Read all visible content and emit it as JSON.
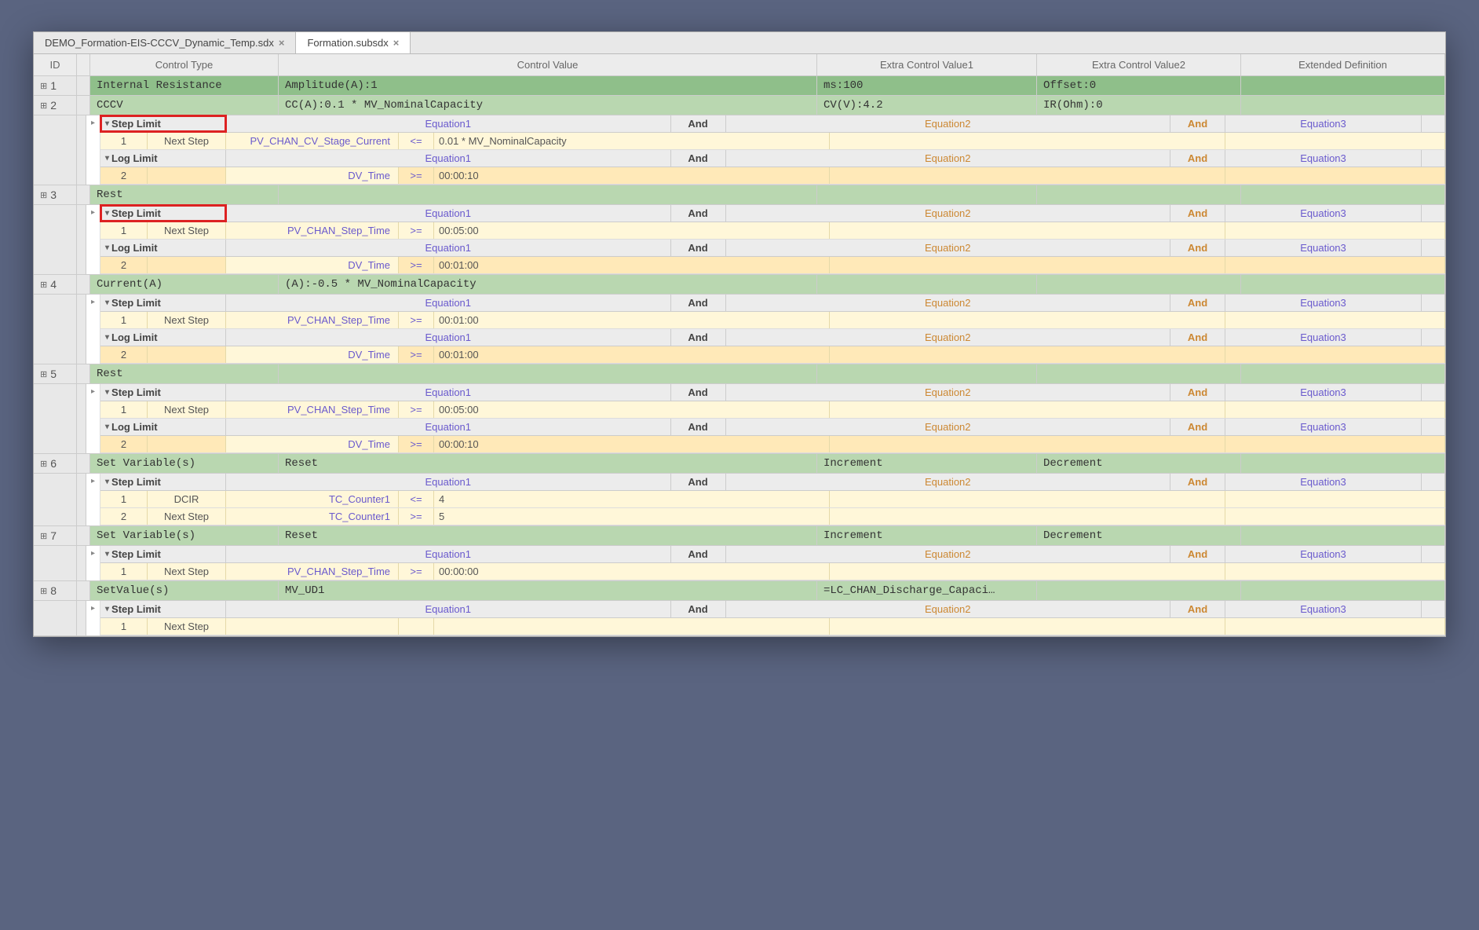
{
  "tabs": [
    {
      "label": "DEMO_Formation-EIS-CCCV_Dynamic_Temp.sdx",
      "active": false
    },
    {
      "label": "Formation.subsdx",
      "active": true
    }
  ],
  "headers": {
    "id": "ID",
    "type": "Control Type",
    "value": "Control Value",
    "extra1": "Extra Control Value1",
    "extra2": "Extra Control Value2",
    "ext": "Extended Definition"
  },
  "limit_labels": {
    "step": "Step Limit",
    "log": "Log Limit",
    "eq1": "Equation1",
    "eq2": "Equation2",
    "eq3": "Equation3",
    "and": "And"
  },
  "steps": [
    {
      "id": "1",
      "rowClass": "darkgreen",
      "type": "Internal Resistance",
      "value": "Amplitude(A):1",
      "extra1": "ms:100",
      "extra2": "Offset:0",
      "limits": []
    },
    {
      "id": "2",
      "rowClass": "green",
      "type": "CCCV",
      "value": "CC(A):0.1 * MV_NominalCapacity",
      "extra1": "CV(V):4.2",
      "extra2": "IR(Ohm):0",
      "limits": [
        {
          "kind": "step",
          "redbox": true,
          "rows": [
            {
              "num": "1",
              "act": "Next Step",
              "var": "PV_CHAN_CV_Stage_Current",
              "op": "<=",
              "val": "0.01 * MV_NominalCapacity"
            }
          ]
        },
        {
          "kind": "log",
          "rows": [
            {
              "num": "2",
              "act": "",
              "var": "DV_Time",
              "op": ">=",
              "val": "00:00:10",
              "orange": true
            }
          ]
        }
      ]
    },
    {
      "id": "3",
      "rowClass": "green",
      "type": "Rest",
      "value": "",
      "extra1": "",
      "extra2": "",
      "limits": [
        {
          "kind": "step",
          "redbox": true,
          "rows": [
            {
              "num": "1",
              "act": "Next Step",
              "var": "PV_CHAN_Step_Time",
              "op": ">=",
              "val": "00:05:00"
            }
          ]
        },
        {
          "kind": "log",
          "rows": [
            {
              "num": "2",
              "act": "",
              "var": "DV_Time",
              "op": ">=",
              "val": "00:01:00",
              "orange": true
            }
          ]
        }
      ]
    },
    {
      "id": "4",
      "rowClass": "green",
      "type": "Current(A)",
      "value": "(A):-0.5 * MV_NominalCapacity",
      "extra1": "",
      "extra2": "",
      "limits": [
        {
          "kind": "step",
          "rows": [
            {
              "num": "1",
              "act": "Next Step",
              "var": "PV_CHAN_Step_Time",
              "op": ">=",
              "val": "00:01:00"
            }
          ]
        },
        {
          "kind": "log",
          "rows": [
            {
              "num": "2",
              "act": "",
              "var": "DV_Time",
              "op": ">=",
              "val": "00:01:00",
              "orange": true
            }
          ]
        }
      ]
    },
    {
      "id": "5",
      "rowClass": "green",
      "type": "Rest",
      "value": "",
      "extra1": "",
      "extra2": "",
      "limits": [
        {
          "kind": "step",
          "rows": [
            {
              "num": "1",
              "act": "Next Step",
              "var": "PV_CHAN_Step_Time",
              "op": ">=",
              "val": "00:05:00"
            }
          ]
        },
        {
          "kind": "log",
          "rows": [
            {
              "num": "2",
              "act": "",
              "var": "DV_Time",
              "op": ">=",
              "val": "00:00:10",
              "orange": true
            }
          ]
        }
      ]
    },
    {
      "id": "6",
      "rowClass": "green",
      "type": "Set Variable(s)",
      "value": "Reset",
      "extra1": "Increment",
      "extra2": "Decrement",
      "limits": [
        {
          "kind": "step",
          "rows": [
            {
              "num": "1",
              "act": "DCIR",
              "var": "TC_Counter1",
              "op": "<=",
              "val": "4"
            },
            {
              "num": "2",
              "act": "Next Step",
              "var": "TC_Counter1",
              "op": ">=",
              "val": "5"
            }
          ]
        }
      ]
    },
    {
      "id": "7",
      "rowClass": "green",
      "type": "Set Variable(s)",
      "value": "Reset",
      "extra1": "Increment",
      "extra2": "Decrement",
      "limits": [
        {
          "kind": "step",
          "rows": [
            {
              "num": "1",
              "act": "Next Step",
              "var": "PV_CHAN_Step_Time",
              "op": ">=",
              "val": "00:00:00"
            }
          ]
        }
      ]
    },
    {
      "id": "8",
      "rowClass": "green",
      "type": "SetValue(s)",
      "value": "MV_UD1",
      "extra1": "=LC_CHAN_Discharge_Capaci…",
      "extra2": "",
      "limits": [
        {
          "kind": "step",
          "rows": [
            {
              "num": "1",
              "act": "Next Step",
              "var": "",
              "op": "",
              "val": ""
            }
          ]
        }
      ]
    }
  ]
}
